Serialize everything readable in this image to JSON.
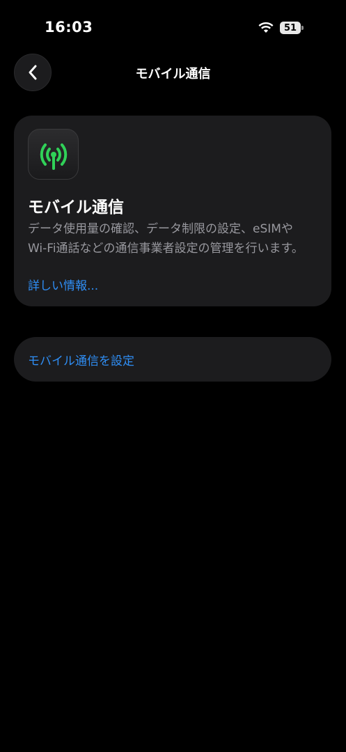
{
  "status_bar": {
    "time": "16:03",
    "battery": "51",
    "icons": [
      "wifi-icon",
      "battery-icon"
    ]
  },
  "nav": {
    "title": "モバイル通信",
    "back_icon": "chevron-left-icon"
  },
  "info_card": {
    "icon": "antenna-icon",
    "icon_color": "#30d158",
    "title": "モバイル通信",
    "description": "データ使用量の確認、データ制限の設定、eSIMやWi-Fi通話などの通信事業者設定の管理を行います。",
    "link": "詳しい情報..."
  },
  "action": {
    "label": "モバイル通信を設定"
  },
  "colors": {
    "background": "#000000",
    "card": "#1c1c1e",
    "link": "#2f8ef5",
    "secondary_text": "#98989e"
  }
}
